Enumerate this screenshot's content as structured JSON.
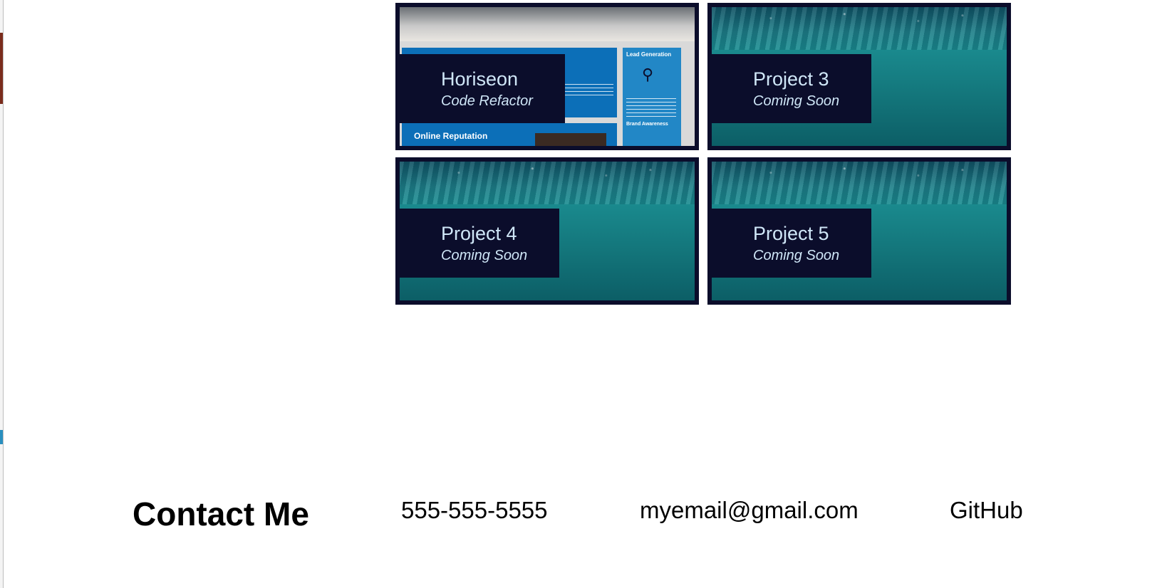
{
  "colors": {
    "card_bg": "#0b0d2b",
    "label_text": "#cfe6f7",
    "water": "#1a8a8e"
  },
  "projects": [
    {
      "title": "Horiseon",
      "subtitle": "Code Refactor",
      "image": "horiseon-site-screenshot",
      "preview": {
        "lead": "Lead Generation",
        "online": "Online Reputation",
        "brand": "Brand Awareness"
      }
    },
    {
      "title": "Project 3",
      "subtitle": "Coming Soon",
      "image": "underwater"
    },
    {
      "title": "Project 4",
      "subtitle": "Coming Soon",
      "image": "underwater"
    },
    {
      "title": "Project 5",
      "subtitle": "Coming Soon",
      "image": "underwater"
    }
  ],
  "contact": {
    "heading": "Contact Me",
    "phone": "555-555-5555",
    "email": "myemail@gmail.com",
    "github": "GitHub"
  }
}
